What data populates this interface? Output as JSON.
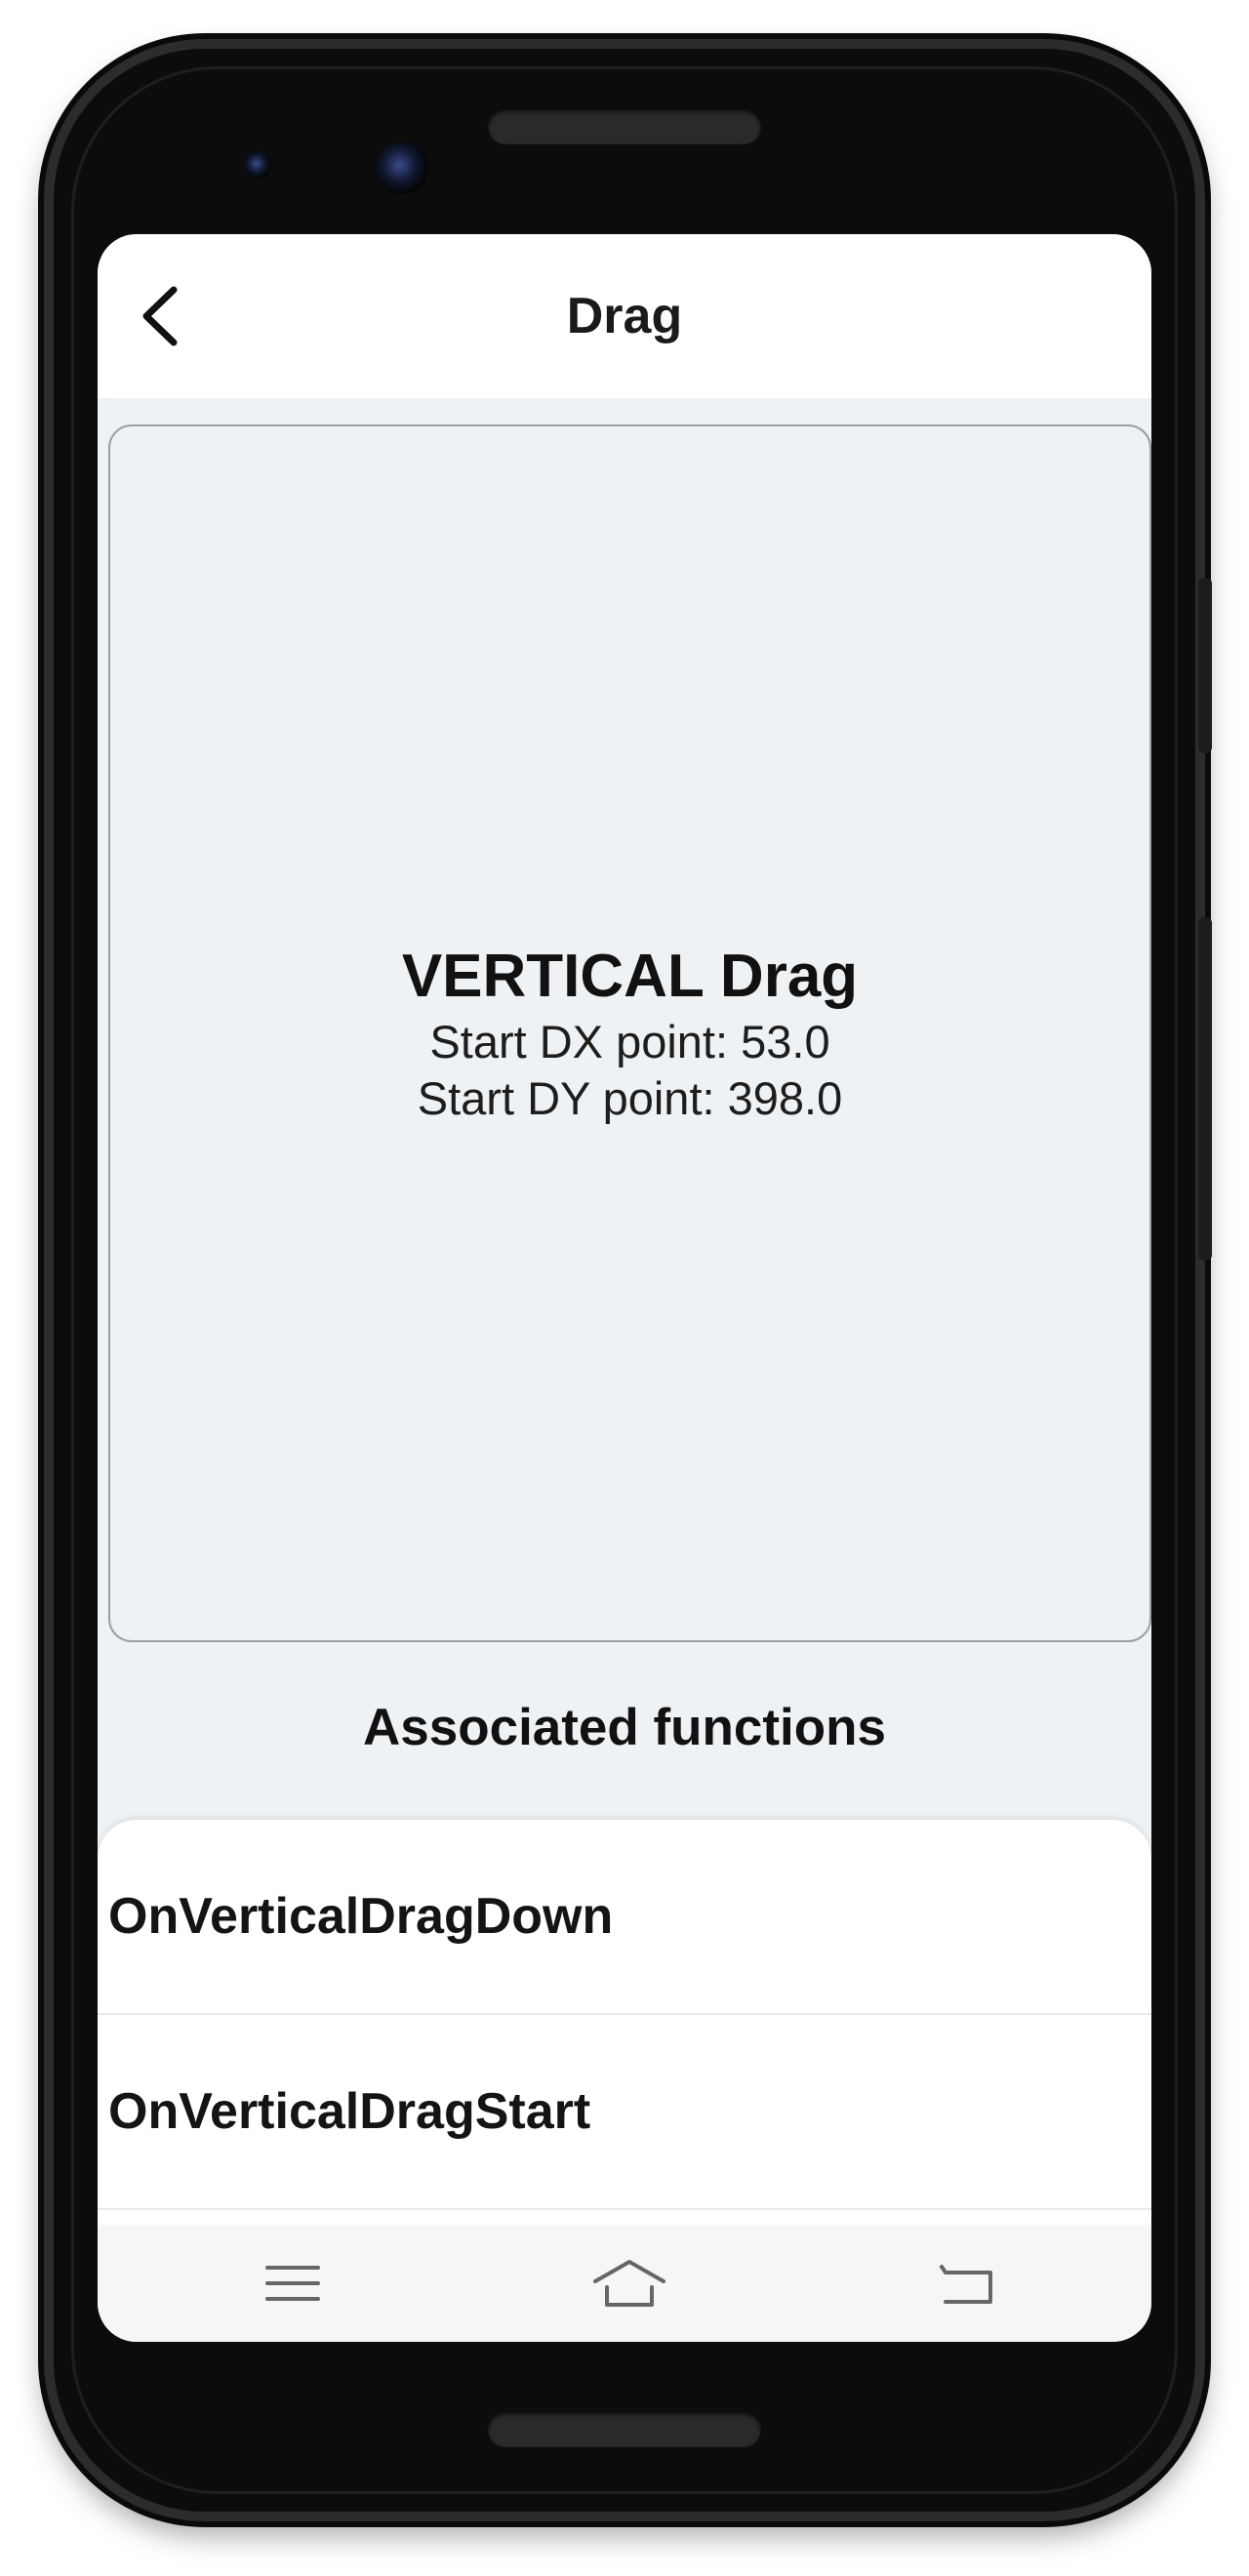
{
  "app": {
    "title": "Drag"
  },
  "drag_area": {
    "heading": "VERTICAL Drag",
    "start_dx": "Start DX point: 53.0",
    "start_dy": "Start DY point: 398.0"
  },
  "associated": {
    "title": "Associated functions",
    "items": [
      {
        "label": "OnVerticalDragDown"
      },
      {
        "label": "OnVerticalDragStart"
      }
    ]
  },
  "icons": {
    "back": "chevron-left-icon",
    "menu": "menu-icon",
    "home": "home-icon",
    "back_nav": "return-icon"
  },
  "colors": {
    "background": "#eff2f5",
    "surface": "#ffffff",
    "text": "#111111",
    "border": "#9a9ea3"
  }
}
